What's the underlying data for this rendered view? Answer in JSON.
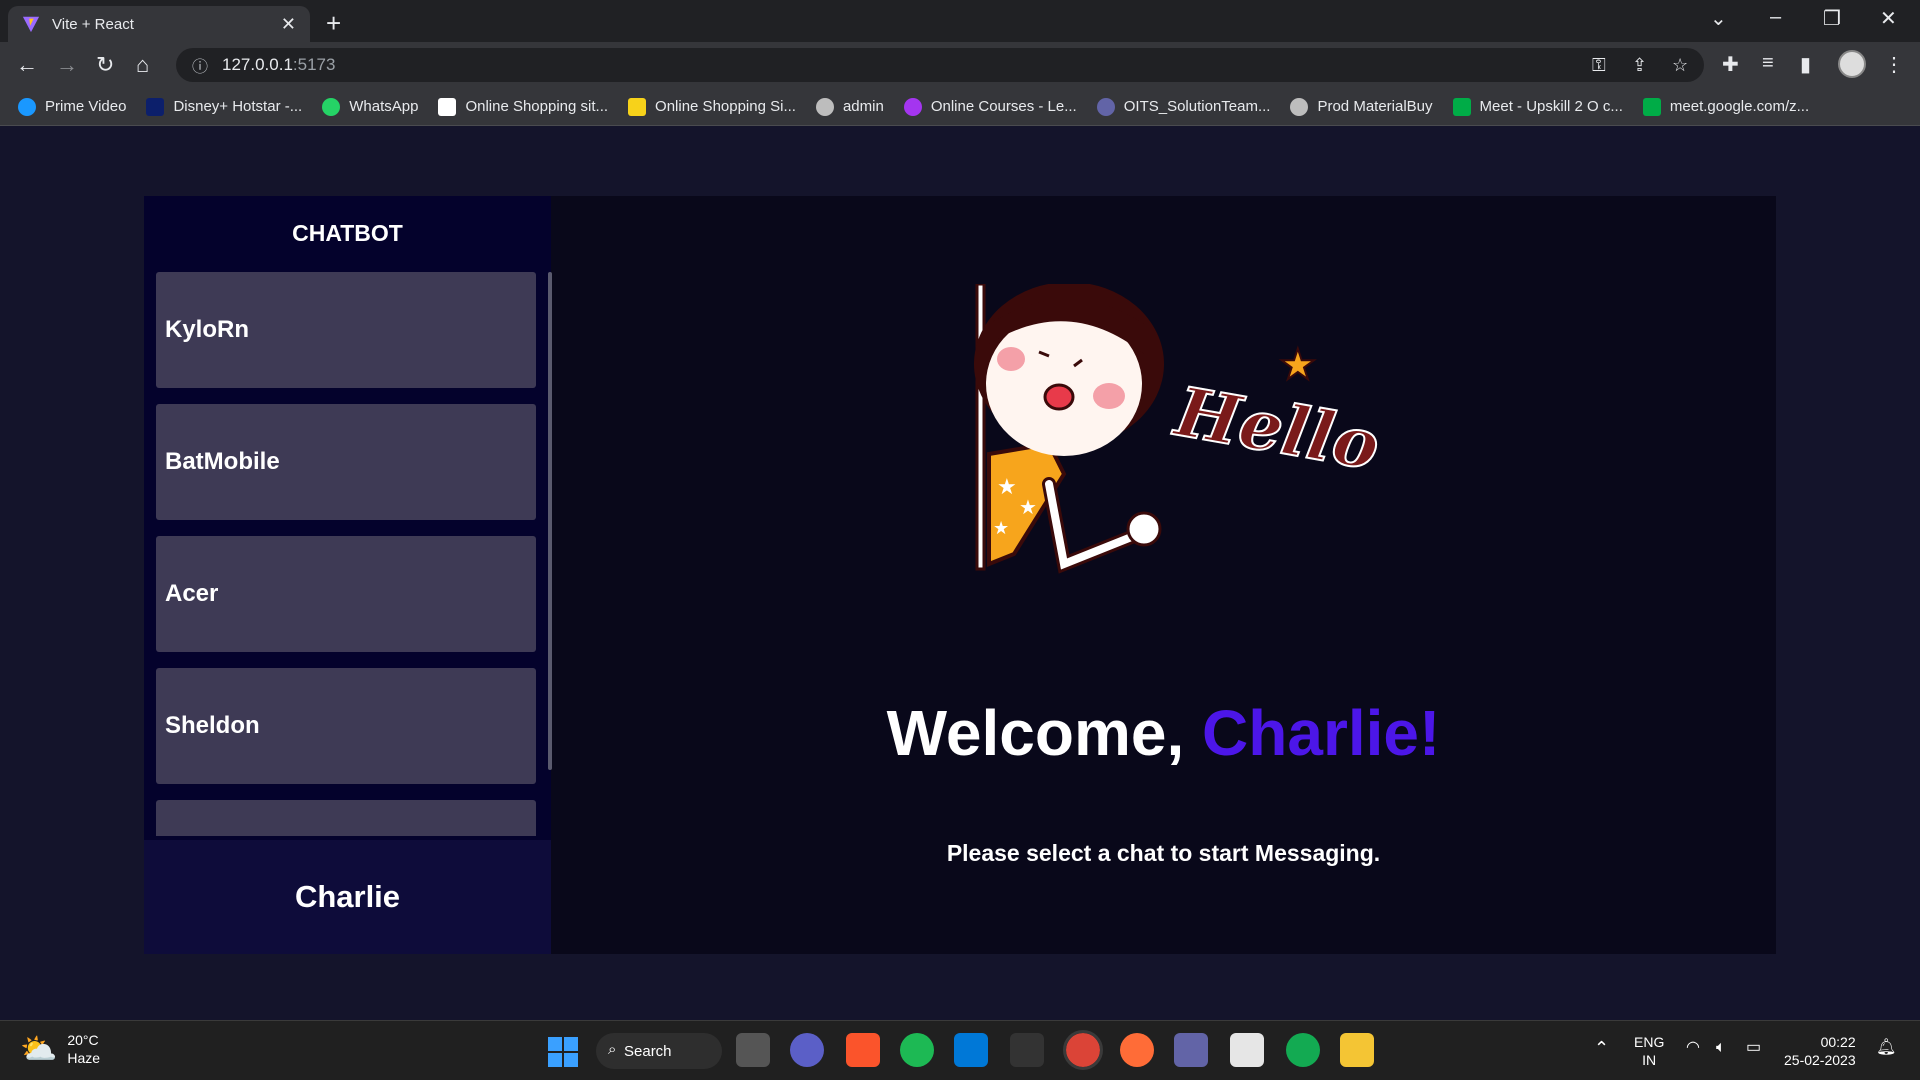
{
  "browser": {
    "tab_title": "Vite + React",
    "url_host": "127.0.0.1",
    "url_port": ":5173",
    "bookmarks": [
      {
        "label": "Prime Video",
        "color": "#1a98ff"
      },
      {
        "label": "Disney+ Hotstar -...",
        "color": "#0c1f6b"
      },
      {
        "label": "WhatsApp",
        "color": "#25d366"
      },
      {
        "label": "Online Shopping sit...",
        "color": "#ffffff"
      },
      {
        "label": "Online Shopping Si...",
        "color": "#f7d21a"
      },
      {
        "label": "admin",
        "color": "#bdbdbd"
      },
      {
        "label": "Online Courses - Le...",
        "color": "#a435f0"
      },
      {
        "label": "OITS_SolutionTeam...",
        "color": "#6264a7"
      },
      {
        "label": "Prod MaterialBuy",
        "color": "#bdbdbd"
      },
      {
        "label": "Meet - Upskill 2 O c...",
        "color": "#00ac47"
      },
      {
        "label": "meet.google.com/z...",
        "color": "#00ac47"
      }
    ]
  },
  "sidebar": {
    "title": "CHATBOT",
    "chats": [
      {
        "name": "KyloRn"
      },
      {
        "name": "BatMobile"
      },
      {
        "name": "Acer"
      },
      {
        "name": "Sheldon"
      },
      {
        "name": ""
      }
    ],
    "current_user": "Charlie"
  },
  "main": {
    "welcome_prefix": "Welcome, ",
    "welcome_name": "Charlie!",
    "subtitle": "Please select a chat to start Messaging.",
    "illustration_text": "Hello",
    "accent_color": "#4c16e8"
  },
  "taskbar": {
    "temperature": "20°C",
    "weather": "Haze",
    "search_label": "Search",
    "lang_line1": "ENG",
    "lang_line2": "IN",
    "time": "00:22",
    "date": "25-02-2023"
  }
}
